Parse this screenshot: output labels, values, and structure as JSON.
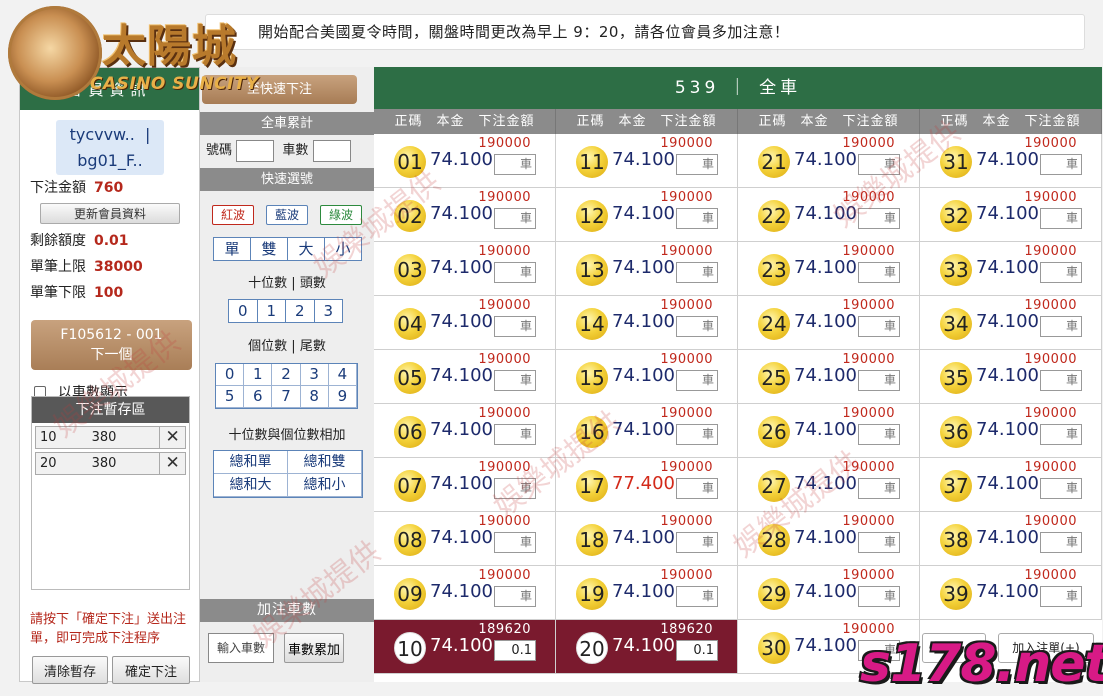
{
  "notice": "開始配合美國夏令時間，關盤時間更改為早上 9：20，請各位會員多加注意！",
  "logo": {
    "cn": "太陽城",
    "en": "CASINO SUNCITY"
  },
  "left": {
    "header": "會員資訊",
    "user_line1": "tycvvw..",
    "user_sep": "|",
    "user_line2": "bg01_F..",
    "bet_amount_label": "下注金額",
    "bet_amount_value": "760",
    "update_button": "更新會員資料",
    "balance_label": "剩餘額度",
    "balance_value": "0.01",
    "max_label": "單筆上限",
    "max_value": "38000",
    "min_label": "單筆下限",
    "min_value": "100",
    "order_id": "F105612 - 001",
    "next_label": "下一個",
    "car_display_label": "以車數顯示",
    "temp_header": "下注暫存區",
    "temp_items": [
      {
        "num": "10",
        "amount": "380",
        "remove": "✕"
      },
      {
        "num": "20",
        "amount": "380",
        "remove": "✕"
      }
    ],
    "hint": "請按下「確定下注」送出注單，即可完成下注程序",
    "clear_button": "清除暫存",
    "confirm_button": "確定下注"
  },
  "middle": {
    "quick_bet_button": "至快速下注",
    "total_header": "全車累計",
    "num_label": "號碼",
    "car_label": "車數",
    "quick_pick_header": "快速選號",
    "waves": [
      "紅波",
      "藍波",
      "綠波"
    ],
    "odd_even": [
      "單",
      "雙",
      "大",
      "小"
    ],
    "tens_label": "十位數 | 頭數",
    "tens_digits": [
      "0",
      "1",
      "2",
      "3"
    ],
    "units_label": "個位數 | 尾數",
    "units_digits": [
      "0",
      "1",
      "2",
      "3",
      "4",
      "5",
      "6",
      "7",
      "8",
      "9"
    ],
    "sum_label": "十位數與個位數相加",
    "sums": [
      "總和單",
      "總和雙",
      "總和大",
      "總和小"
    ],
    "add_header": "加注車數",
    "car_input_label": "輸入車數",
    "car_accumulate_button": "車數累加"
  },
  "main": {
    "title": "539 ｜ 全車",
    "column_header": "正碼　本金　下注金額",
    "add_bet_button": "加入注單(+)",
    "cells": [
      {
        "num": "01",
        "cap": "190000",
        "odds": "74.100",
        "bet": "車"
      },
      {
        "num": "11",
        "cap": "190000",
        "odds": "74.100",
        "bet": "車"
      },
      {
        "num": "21",
        "cap": "190000",
        "odds": "74.100",
        "bet": "車"
      },
      {
        "num": "31",
        "cap": "190000",
        "odds": "74.100",
        "bet": "車"
      },
      {
        "num": "02",
        "cap": "190000",
        "odds": "74.100",
        "bet": "車"
      },
      {
        "num": "12",
        "cap": "190000",
        "odds": "74.100",
        "bet": "車"
      },
      {
        "num": "22",
        "cap": "190000",
        "odds": "74.100",
        "bet": "車"
      },
      {
        "num": "32",
        "cap": "190000",
        "odds": "74.100",
        "bet": "車"
      },
      {
        "num": "03",
        "cap": "190000",
        "odds": "74.100",
        "bet": "車"
      },
      {
        "num": "13",
        "cap": "190000",
        "odds": "74.100",
        "bet": "車"
      },
      {
        "num": "23",
        "cap": "190000",
        "odds": "74.100",
        "bet": "車"
      },
      {
        "num": "33",
        "cap": "190000",
        "odds": "74.100",
        "bet": "車"
      },
      {
        "num": "04",
        "cap": "190000",
        "odds": "74.100",
        "bet": "車"
      },
      {
        "num": "14",
        "cap": "190000",
        "odds": "74.100",
        "bet": "車"
      },
      {
        "num": "24",
        "cap": "190000",
        "odds": "74.100",
        "bet": "車"
      },
      {
        "num": "34",
        "cap": "190000",
        "odds": "74.100",
        "bet": "車"
      },
      {
        "num": "05",
        "cap": "190000",
        "odds": "74.100",
        "bet": "車"
      },
      {
        "num": "15",
        "cap": "190000",
        "odds": "74.100",
        "bet": "車"
      },
      {
        "num": "25",
        "cap": "190000",
        "odds": "74.100",
        "bet": "車"
      },
      {
        "num": "35",
        "cap": "190000",
        "odds": "74.100",
        "bet": "車"
      },
      {
        "num": "06",
        "cap": "190000",
        "odds": "74.100",
        "bet": "車"
      },
      {
        "num": "16",
        "cap": "190000",
        "odds": "74.100",
        "bet": "車"
      },
      {
        "num": "26",
        "cap": "190000",
        "odds": "74.100",
        "bet": "車"
      },
      {
        "num": "36",
        "cap": "190000",
        "odds": "74.100",
        "bet": "車"
      },
      {
        "num": "07",
        "cap": "190000",
        "odds": "74.100",
        "bet": "車"
      },
      {
        "num": "17",
        "cap": "190000",
        "odds": "77.400",
        "bet": "車",
        "red": true
      },
      {
        "num": "27",
        "cap": "190000",
        "odds": "74.100",
        "bet": "車"
      },
      {
        "num": "37",
        "cap": "190000",
        "odds": "74.100",
        "bet": "車"
      },
      {
        "num": "08",
        "cap": "190000",
        "odds": "74.100",
        "bet": "車"
      },
      {
        "num": "18",
        "cap": "190000",
        "odds": "74.100",
        "bet": "車"
      },
      {
        "num": "28",
        "cap": "190000",
        "odds": "74.100",
        "bet": "車"
      },
      {
        "num": "38",
        "cap": "190000",
        "odds": "74.100",
        "bet": "車"
      },
      {
        "num": "09",
        "cap": "190000",
        "odds": "74.100",
        "bet": "車"
      },
      {
        "num": "19",
        "cap": "190000",
        "odds": "74.100",
        "bet": "車"
      },
      {
        "num": "29",
        "cap": "190000",
        "odds": "74.100",
        "bet": "車"
      },
      {
        "num": "39",
        "cap": "190000",
        "odds": "74.100",
        "bet": "車"
      },
      {
        "num": "10",
        "cap": "189620",
        "odds": "74.100",
        "bet": "0.1",
        "dark": true
      },
      {
        "num": "20",
        "cap": "189620",
        "odds": "74.100",
        "bet": "0.1",
        "dark": true
      },
      {
        "num": "30",
        "cap": "190000",
        "odds": "74.100",
        "bet": "車"
      }
    ]
  },
  "watermark_text": "娛樂城提供",
  "brand": "s178.net"
}
